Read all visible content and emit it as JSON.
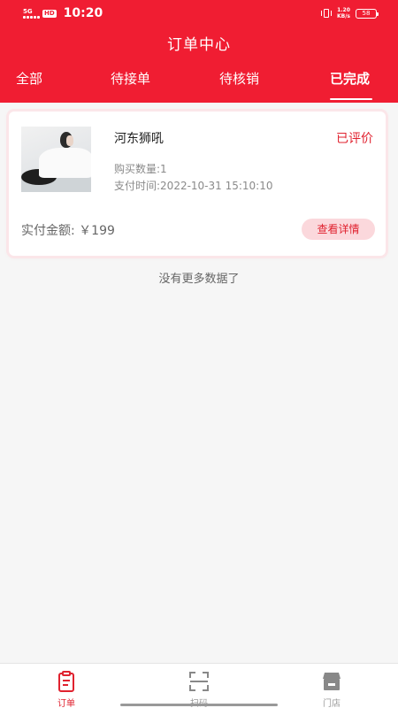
{
  "status_bar": {
    "network": "5G",
    "hd": "HD",
    "time": "10:20",
    "net_speed_value": "1.20",
    "net_speed_unit": "KB/s",
    "battery": "58"
  },
  "header": {
    "title": "订单中心",
    "tabs": [
      {
        "label": "全部"
      },
      {
        "label": "待接单"
      },
      {
        "label": "待核销"
      },
      {
        "label": "已完成"
      }
    ],
    "active_tab": "已完成"
  },
  "order": {
    "product_name": "河东狮吼",
    "status": "已评价",
    "quantity": "购买数量:1",
    "pay_time": "支付时间:2022-10-31 15:10:10",
    "paid_amount": "实付金额: ￥199",
    "detail_button": "查看详情"
  },
  "list_end_text": "没有更多数据了",
  "bottom_nav": {
    "items": [
      {
        "label": "订单",
        "icon": "clipboard-icon"
      },
      {
        "label": "扫码",
        "icon": "scan-icon"
      },
      {
        "label": "门店",
        "icon": "store-icon"
      }
    ],
    "active": "订单"
  },
  "colors": {
    "brand": "#f01d32",
    "accent_text": "#e0222f",
    "button_bg": "#fbd8dc"
  }
}
